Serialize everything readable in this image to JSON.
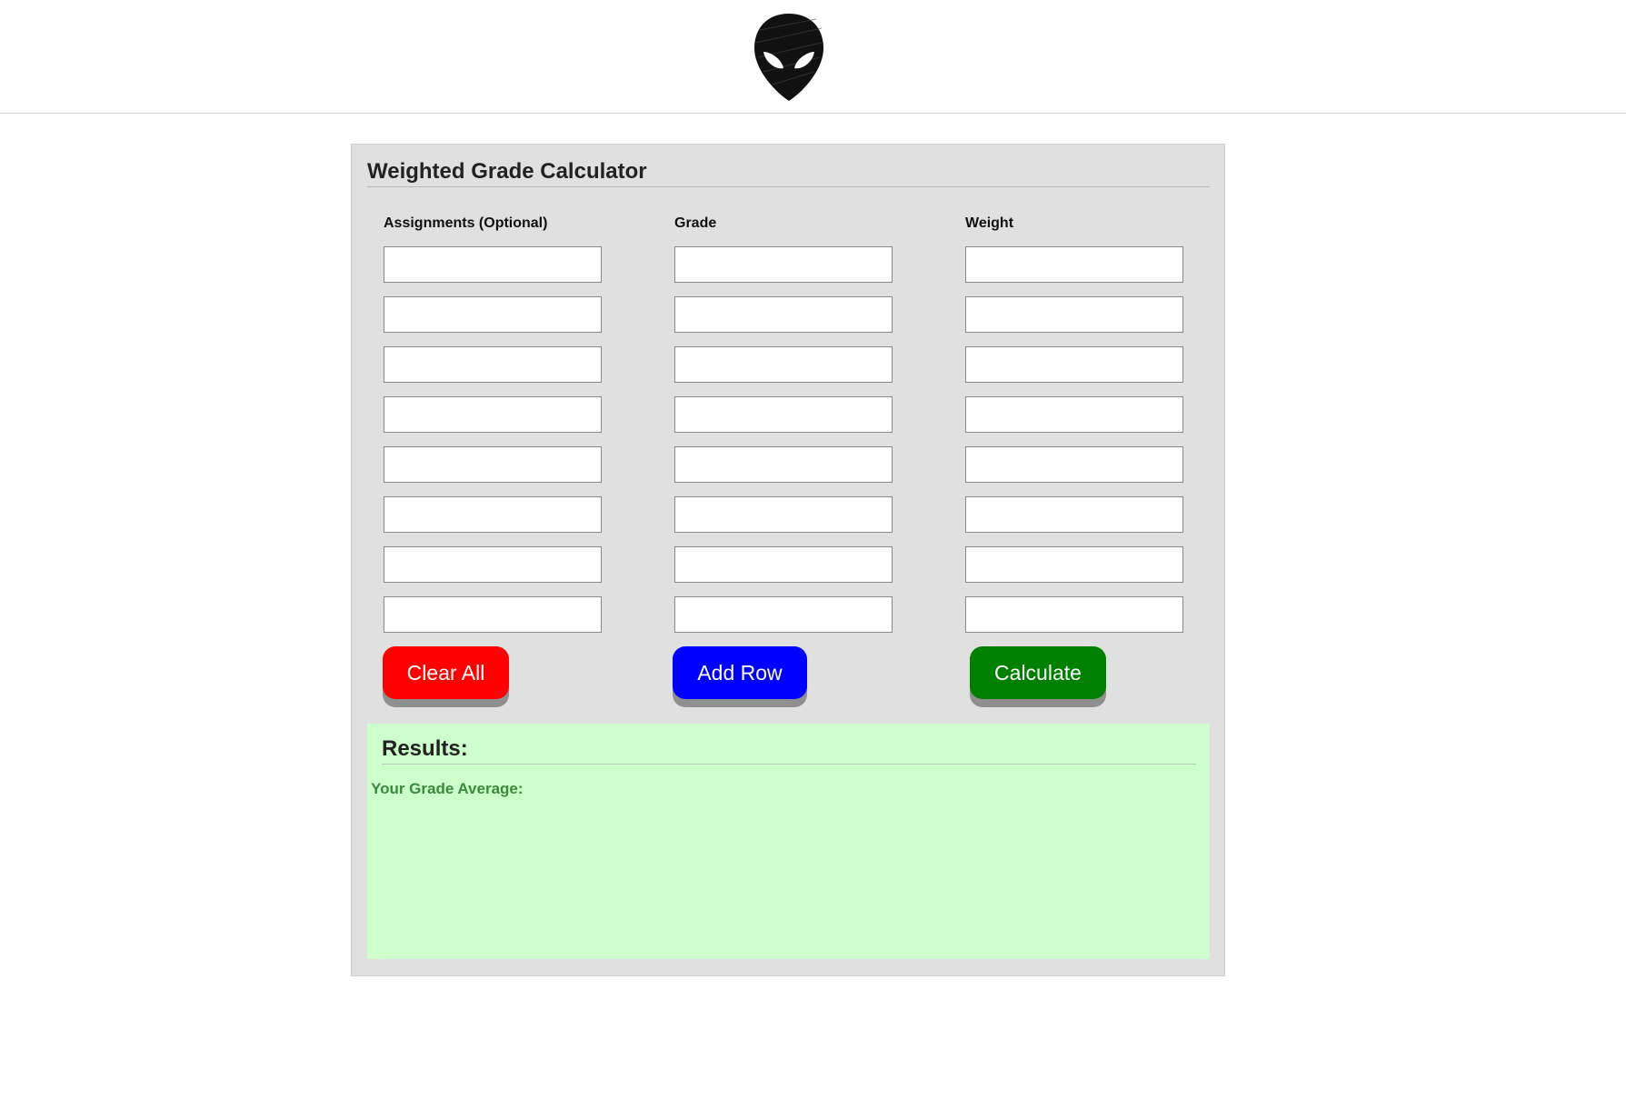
{
  "header": {
    "logo_icon": "alien-head-icon"
  },
  "calculator": {
    "title": "Weighted Grade Calculator",
    "columns": {
      "assignments": "Assignments (Optional)",
      "grade": "Grade",
      "weight": "Weight"
    },
    "rows": [
      {
        "assignment": "",
        "grade": "",
        "weight": ""
      },
      {
        "assignment": "",
        "grade": "",
        "weight": ""
      },
      {
        "assignment": "",
        "grade": "",
        "weight": ""
      },
      {
        "assignment": "",
        "grade": "",
        "weight": ""
      },
      {
        "assignment": "",
        "grade": "",
        "weight": ""
      },
      {
        "assignment": "",
        "grade": "",
        "weight": ""
      },
      {
        "assignment": "",
        "grade": "",
        "weight": ""
      },
      {
        "assignment": "",
        "grade": "",
        "weight": ""
      }
    ],
    "buttons": {
      "clear_all": "Clear All",
      "add_row": "Add Row",
      "calculate": "Calculate"
    }
  },
  "results": {
    "title": "Results:",
    "average_label": "Your Grade Average:"
  },
  "colors": {
    "clear_button": "#ff0000",
    "add_row_button": "#0000ff",
    "calculate_button": "#008000",
    "results_background": "#ccffcc",
    "panel_background": "#e0e0e0"
  }
}
